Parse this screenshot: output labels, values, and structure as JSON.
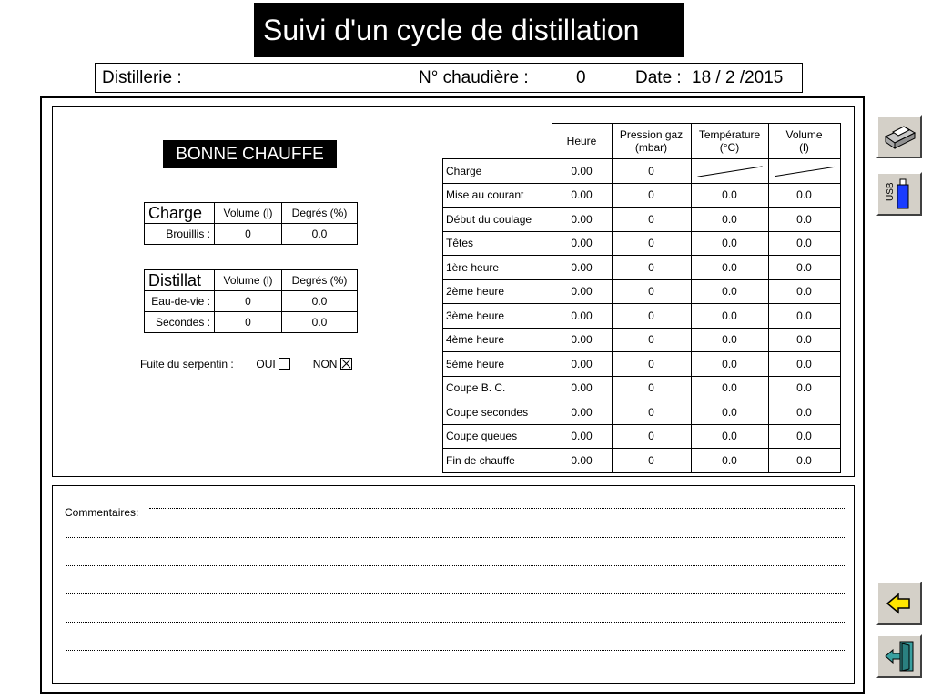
{
  "title": "Suivi d'un cycle de distillation",
  "info": {
    "distillerie_label": "Distillerie :",
    "chaudiere_label": "N° chaudière :",
    "chaudiere_value": "0",
    "date_label": "Date :",
    "date_value": "18 / 2  /2015"
  },
  "badge": "BONNE CHAUFFE",
  "charge": {
    "title": "Charge",
    "col_volume": "Volume (l)",
    "col_degres": "Degrés (%)",
    "rows": [
      {
        "label": "Brouillis :",
        "volume": "0",
        "degres": "0.0"
      }
    ]
  },
  "distillat": {
    "title": "Distillat",
    "col_volume": "Volume (l)",
    "col_degres": "Degrés (%)",
    "rows": [
      {
        "label": "Eau-de-vie :",
        "volume": "0",
        "degres": "0.0"
      },
      {
        "label": "Secondes :",
        "volume": "0",
        "degres": "0.0"
      }
    ]
  },
  "fuite": {
    "label": "Fuite du serpentin :",
    "oui_label": "OUI",
    "oui_checked": false,
    "non_label": "NON",
    "non_checked": true
  },
  "table": {
    "headers": {
      "heure": "Heure",
      "pression_1": "Pression gaz",
      "pression_2": "(mbar)",
      "temperature_1": "Température",
      "temperature_2": "(°C)",
      "volume_1": "Volume",
      "volume_2": "(l)"
    },
    "rows": [
      {
        "label": "Charge",
        "heure": "0.00",
        "pression": "0",
        "temperature": "",
        "volume": ""
      },
      {
        "label": "Mise au courant",
        "heure": "0.00",
        "pression": "0",
        "temperature": "0.0",
        "volume": "0.0"
      },
      {
        "label": "Début du coulage",
        "heure": "0.00",
        "pression": "0",
        "temperature": "0.0",
        "volume": "0.0"
      },
      {
        "label": "Têtes",
        "heure": "0.00",
        "pression": "0",
        "temperature": "0.0",
        "volume": "0.0"
      },
      {
        "label": "1ère heure",
        "heure": "0.00",
        "pression": "0",
        "temperature": "0.0",
        "volume": "0.0"
      },
      {
        "label": "2ème heure",
        "heure": "0.00",
        "pression": "0",
        "temperature": "0.0",
        "volume": "0.0"
      },
      {
        "label": "3ème heure",
        "heure": "0.00",
        "pression": "0",
        "temperature": "0.0",
        "volume": "0.0"
      },
      {
        "label": "4ème heure",
        "heure": "0.00",
        "pression": "0",
        "temperature": "0.0",
        "volume": "0.0"
      },
      {
        "label": "5ème heure",
        "heure": "0.00",
        "pression": "0",
        "temperature": "0.0",
        "volume": "0.0"
      },
      {
        "label": "Coupe B. C.",
        "heure": "0.00",
        "pression": "0",
        "temperature": "0.0",
        "volume": "0.0"
      },
      {
        "label": "Coupe secondes",
        "heure": "0.00",
        "pression": "0",
        "temperature": "0.0",
        "volume": "0.0"
      },
      {
        "label": "Coupe queues",
        "heure": "0.00",
        "pression": "0",
        "temperature": "0.0",
        "volume": "0.0"
      },
      {
        "label": "Fin de chauffe",
        "heure": "0.00",
        "pression": "0",
        "temperature": "0.0",
        "volume": "0.0"
      }
    ]
  },
  "comments": {
    "label": "Commentaires:"
  },
  "sidebar": {
    "print_icon": "printer-icon",
    "usb_icon": "usb-drive-icon",
    "usb_label": "USB",
    "back_icon": "back-arrow-icon",
    "exit_icon": "exit-door-icon"
  }
}
